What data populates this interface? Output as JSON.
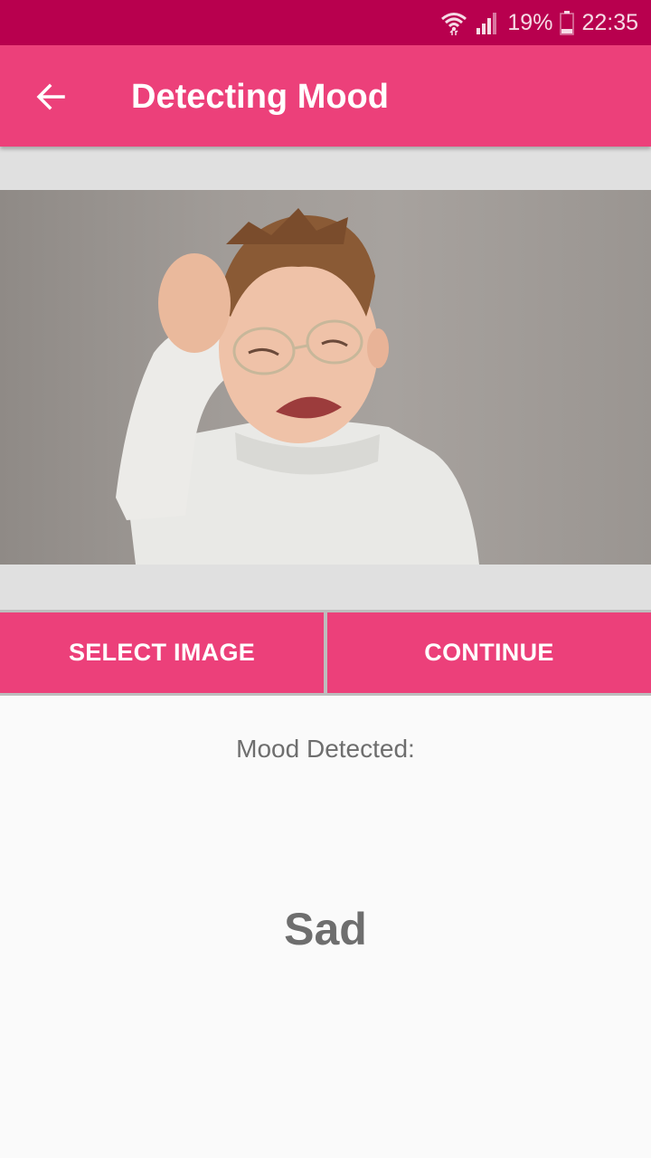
{
  "status_bar": {
    "icons": [
      "wifi-icon",
      "signal-icon",
      "battery-icon"
    ],
    "battery_percent": "19%",
    "time": "22:35"
  },
  "app_bar": {
    "back_icon": "arrow-left-icon",
    "title": "Detecting Mood"
  },
  "photo": {
    "subject": "crying child photo"
  },
  "buttons": {
    "select_image": "SELECT IMAGE",
    "continue": "CONTINUE"
  },
  "result": {
    "label": "Mood Detected:",
    "value": "Sad"
  },
  "colors": {
    "primary": "#ec407a",
    "primary_dark": "#b8004e",
    "text_secondary": "#6e6e6e"
  }
}
